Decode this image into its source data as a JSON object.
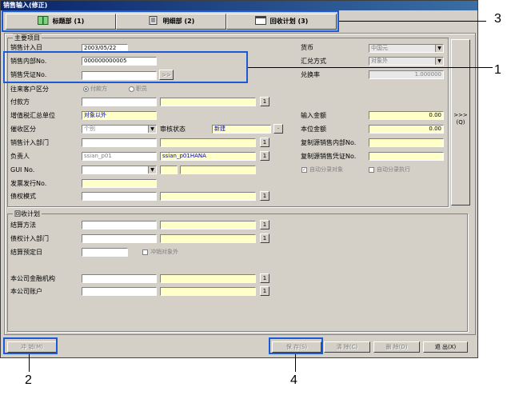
{
  "window": {
    "title": "销售输入(修正)"
  },
  "tabs": [
    {
      "label": "标题部 (1)",
      "icon": "book-icon"
    },
    {
      "label": "明细部 (2)",
      "icon": "document-icon"
    },
    {
      "label": "回收计划 (3)",
      "icon": "window-icon"
    }
  ],
  "main": {
    "title": "主要项目",
    "sales_date": {
      "label": "销售计入日",
      "value": "2003/05/22"
    },
    "internal_no": {
      "label": "销售内部No.",
      "value": "000000000005"
    },
    "voucher_no": {
      "label": "销售凭证No.",
      "value": "",
      "button": ">>"
    },
    "partner_type": {
      "label": "往来客户区分",
      "options": [
        "付款方",
        "职员"
      ],
      "selected": "付款方"
    },
    "payer": {
      "label": "付款方",
      "button": "1"
    },
    "vat_unit": {
      "label": "增值税汇总单位",
      "value": "对象以外"
    },
    "collect_type": {
      "label": "催收区分",
      "value": "个别"
    },
    "review": {
      "label": "审核状态",
      "value": "新建",
      "button": "·"
    },
    "sales_dept": {
      "label": "销售计入部门",
      "button": "1"
    },
    "owner": {
      "label": "负责人",
      "code": "ssian_p01",
      "name": "ssian_p01HANA",
      "button": "1"
    },
    "gui_no": {
      "label": "GUI No."
    },
    "invoice_no": {
      "label": "发票发行No."
    },
    "credit_mode": {
      "label": "债权模式",
      "button": "1"
    },
    "currency": {
      "label": "货币",
      "value": "中国元"
    },
    "exchange_method": {
      "label": "汇兑方式",
      "value": "对象外"
    },
    "exchange_rate": {
      "label": "兑换率",
      "value": "1.000000"
    },
    "input_amount": {
      "label": "输入金额",
      "value": "0.00"
    },
    "local_amount": {
      "label": "本位金额",
      "value": "0.00"
    },
    "copy_internal": {
      "label": "复制源销售内部No."
    },
    "copy_voucher": {
      "label": "复制源销售凭证No."
    },
    "auto_target": {
      "label": "自动分录对象",
      "checked": true
    },
    "auto_exec": {
      "label": "自动分录执行",
      "checked": false
    },
    "side_button": {
      "label": ">>>",
      "sub": "(Q)"
    }
  },
  "collection": {
    "title": "回收计划",
    "settle_method": {
      "label": "结算方法",
      "button": "1"
    },
    "credit_dept": {
      "label": "债权计入部门",
      "button": "1"
    },
    "settle_date": {
      "label": "结算预定日"
    },
    "offset_target": {
      "label": "冲销对象外",
      "checked": false
    },
    "bank": {
      "label": "本公司金融机构",
      "button": "1"
    },
    "account": {
      "label": "本公司账户",
      "button": "1"
    }
  },
  "footer": {
    "reverse": "冲  销(M)",
    "save": "保  存(S)",
    "clear": "清  除(C)",
    "delete": "删  除(D)",
    "exit": "退  出(X)"
  },
  "callouts": [
    "1",
    "2",
    "3",
    "4"
  ],
  "colors": {
    "highlight": "#1a5ad6",
    "required_field": "#ffffc8",
    "title_bar": "#0a246a"
  }
}
